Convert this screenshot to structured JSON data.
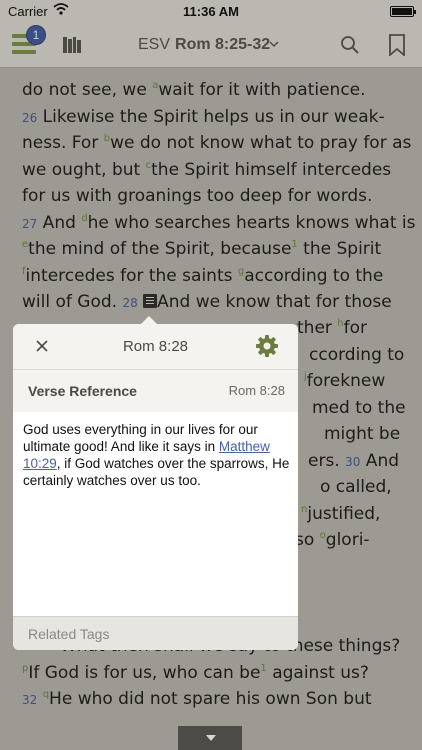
{
  "status_bar": {
    "carrier": "Carrier",
    "time": "11:36 AM"
  },
  "toolbar": {
    "badge_count": "1",
    "version": "ESV",
    "reference": "Rom 8:25-32"
  },
  "reader": {
    "lines": [
      [
        {
          "t": "text",
          "v": "do not see, we "
        },
        {
          "t": "fn",
          "v": "a"
        },
        {
          "t": "text",
          "v": "wait for it with patience."
        }
      ],
      [
        {
          "t": "text",
          "v": "    "
        },
        {
          "t": "vn",
          "v": "26"
        },
        {
          "t": "text",
          "v": " Likewise the Spirit helps us in our weak-"
        }
      ],
      [
        {
          "t": "text",
          "v": "ness. For "
        },
        {
          "t": "fn",
          "v": "b"
        },
        {
          "t": "text",
          "v": "we do not know what to pray for as"
        }
      ],
      [
        {
          "t": "text",
          "v": "we ought, but "
        },
        {
          "t": "fn",
          "v": "c"
        },
        {
          "t": "text",
          "v": "the Spirit himself intercedes"
        }
      ],
      [
        {
          "t": "text",
          "v": "for us with groanings too deep for words."
        }
      ],
      [
        {
          "t": "vn",
          "v": "27"
        },
        {
          "t": "text",
          "v": " And "
        },
        {
          "t": "fn",
          "v": "d"
        },
        {
          "t": "text",
          "v": "he who searches hearts knows what is"
        }
      ],
      [
        {
          "t": "fn",
          "v": "e"
        },
        {
          "t": "text",
          "v": "the mind of the Spirit, because"
        },
        {
          "t": "fn",
          "v": "1"
        },
        {
          "t": "text",
          "v": " the Spirit"
        }
      ],
      [
        {
          "t": "fn",
          "v": "f"
        },
        {
          "t": "text",
          "v": "intercedes for the saints "
        },
        {
          "t": "fn",
          "v": "g"
        },
        {
          "t": "text",
          "v": "according to the"
        }
      ],
      [
        {
          "t": "text",
          "v": "will of God. "
        },
        {
          "t": "vn",
          "v": "28"
        },
        {
          "t": "text",
          "v": " "
        },
        {
          "t": "note",
          "v": ""
        },
        {
          "t": "text",
          "v": "And we know that for those"
        }
      ]
    ],
    "right_fragments": [
      [
        {
          "t": "text",
          "v": "ther "
        },
        {
          "t": "fn",
          "v": "h"
        },
        {
          "t": "text",
          "v": "for"
        }
      ],
      [
        {
          "t": "text",
          "v": "ccording to"
        }
      ],
      [
        {
          "t": "fn",
          "v": "j"
        },
        {
          "t": "text",
          "v": "foreknew"
        }
      ],
      [
        {
          "t": "text",
          "v": "med to the"
        }
      ],
      [
        {
          "t": "text",
          "v": "might be"
        }
      ],
      [
        {
          "t": "text",
          "v": "ers. "
        },
        {
          "t": "vn",
          "v": "30"
        },
        {
          "t": "text",
          "v": " And"
        }
      ],
      [
        {
          "t": "text",
          "v": "o called,"
        }
      ],
      [
        {
          "t": "fn",
          "v": "n"
        },
        {
          "t": "text",
          "v": "justified,"
        }
      ],
      [
        {
          "t": "text",
          "v": "so "
        },
        {
          "t": "fn",
          "v": "o"
        },
        {
          "t": "text",
          "v": "glori-"
        }
      ]
    ],
    "bottom_lines": [
      [
        {
          "t": "text",
          "v": "What then shall we say to these things?"
        }
      ],
      [
        {
          "t": "fn",
          "v": "p"
        },
        {
          "t": "text",
          "v": "If God is for us, who can be"
        },
        {
          "t": "fn",
          "v": "1"
        },
        {
          "t": "text",
          "v": " against us?"
        }
      ],
      [
        {
          "t": "vn",
          "v": "32"
        },
        {
          "t": "text",
          "v": " "
        },
        {
          "t": "fn",
          "v": "q"
        },
        {
          "t": "text",
          "v": "He who did not spare his own Son but"
        }
      ]
    ]
  },
  "popover": {
    "title": "Rom 8:28",
    "section_label": "Verse Reference",
    "section_ref": "Rom 8:28",
    "note_before": "God uses everything in our lives for our ultimate good! And like it says in ",
    "note_link": "Matthew 10:29",
    "note_after": ", if God watches over the sparrows, He certainly watches over us too.",
    "related_tags_label": "Related Tags"
  },
  "colors": {
    "accent_green": "#6a7d3e",
    "badge_blue": "#3b4f86",
    "link_blue": "#4a5fa8"
  }
}
